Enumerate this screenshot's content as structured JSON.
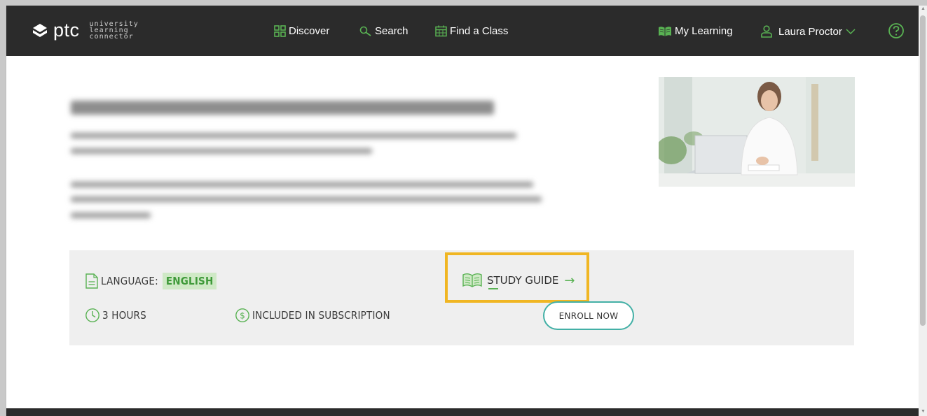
{
  "header": {
    "logo_text": "ptc",
    "logo_tag_lines": [
      "university",
      "learning",
      "connector"
    ],
    "nav": {
      "discover": "Discover",
      "search": "Search",
      "find_class": "Find a Class",
      "my_learning": "My Learning",
      "user_name": "Laura Proctor"
    }
  },
  "course": {
    "language_label": "LANGUAGE:",
    "language_value": "ENGLISH",
    "duration": "3 HOURS",
    "price": "INCLUDED IN SUBSCRIPTION",
    "study_guide": "STUDY GUIDE",
    "enroll_label": "ENROLL NOW"
  },
  "colors": {
    "topbar": "#2b2b2b",
    "accent_green": "#59b253",
    "highlight": "#f0b623",
    "enroll_border": "#43b0a6"
  }
}
